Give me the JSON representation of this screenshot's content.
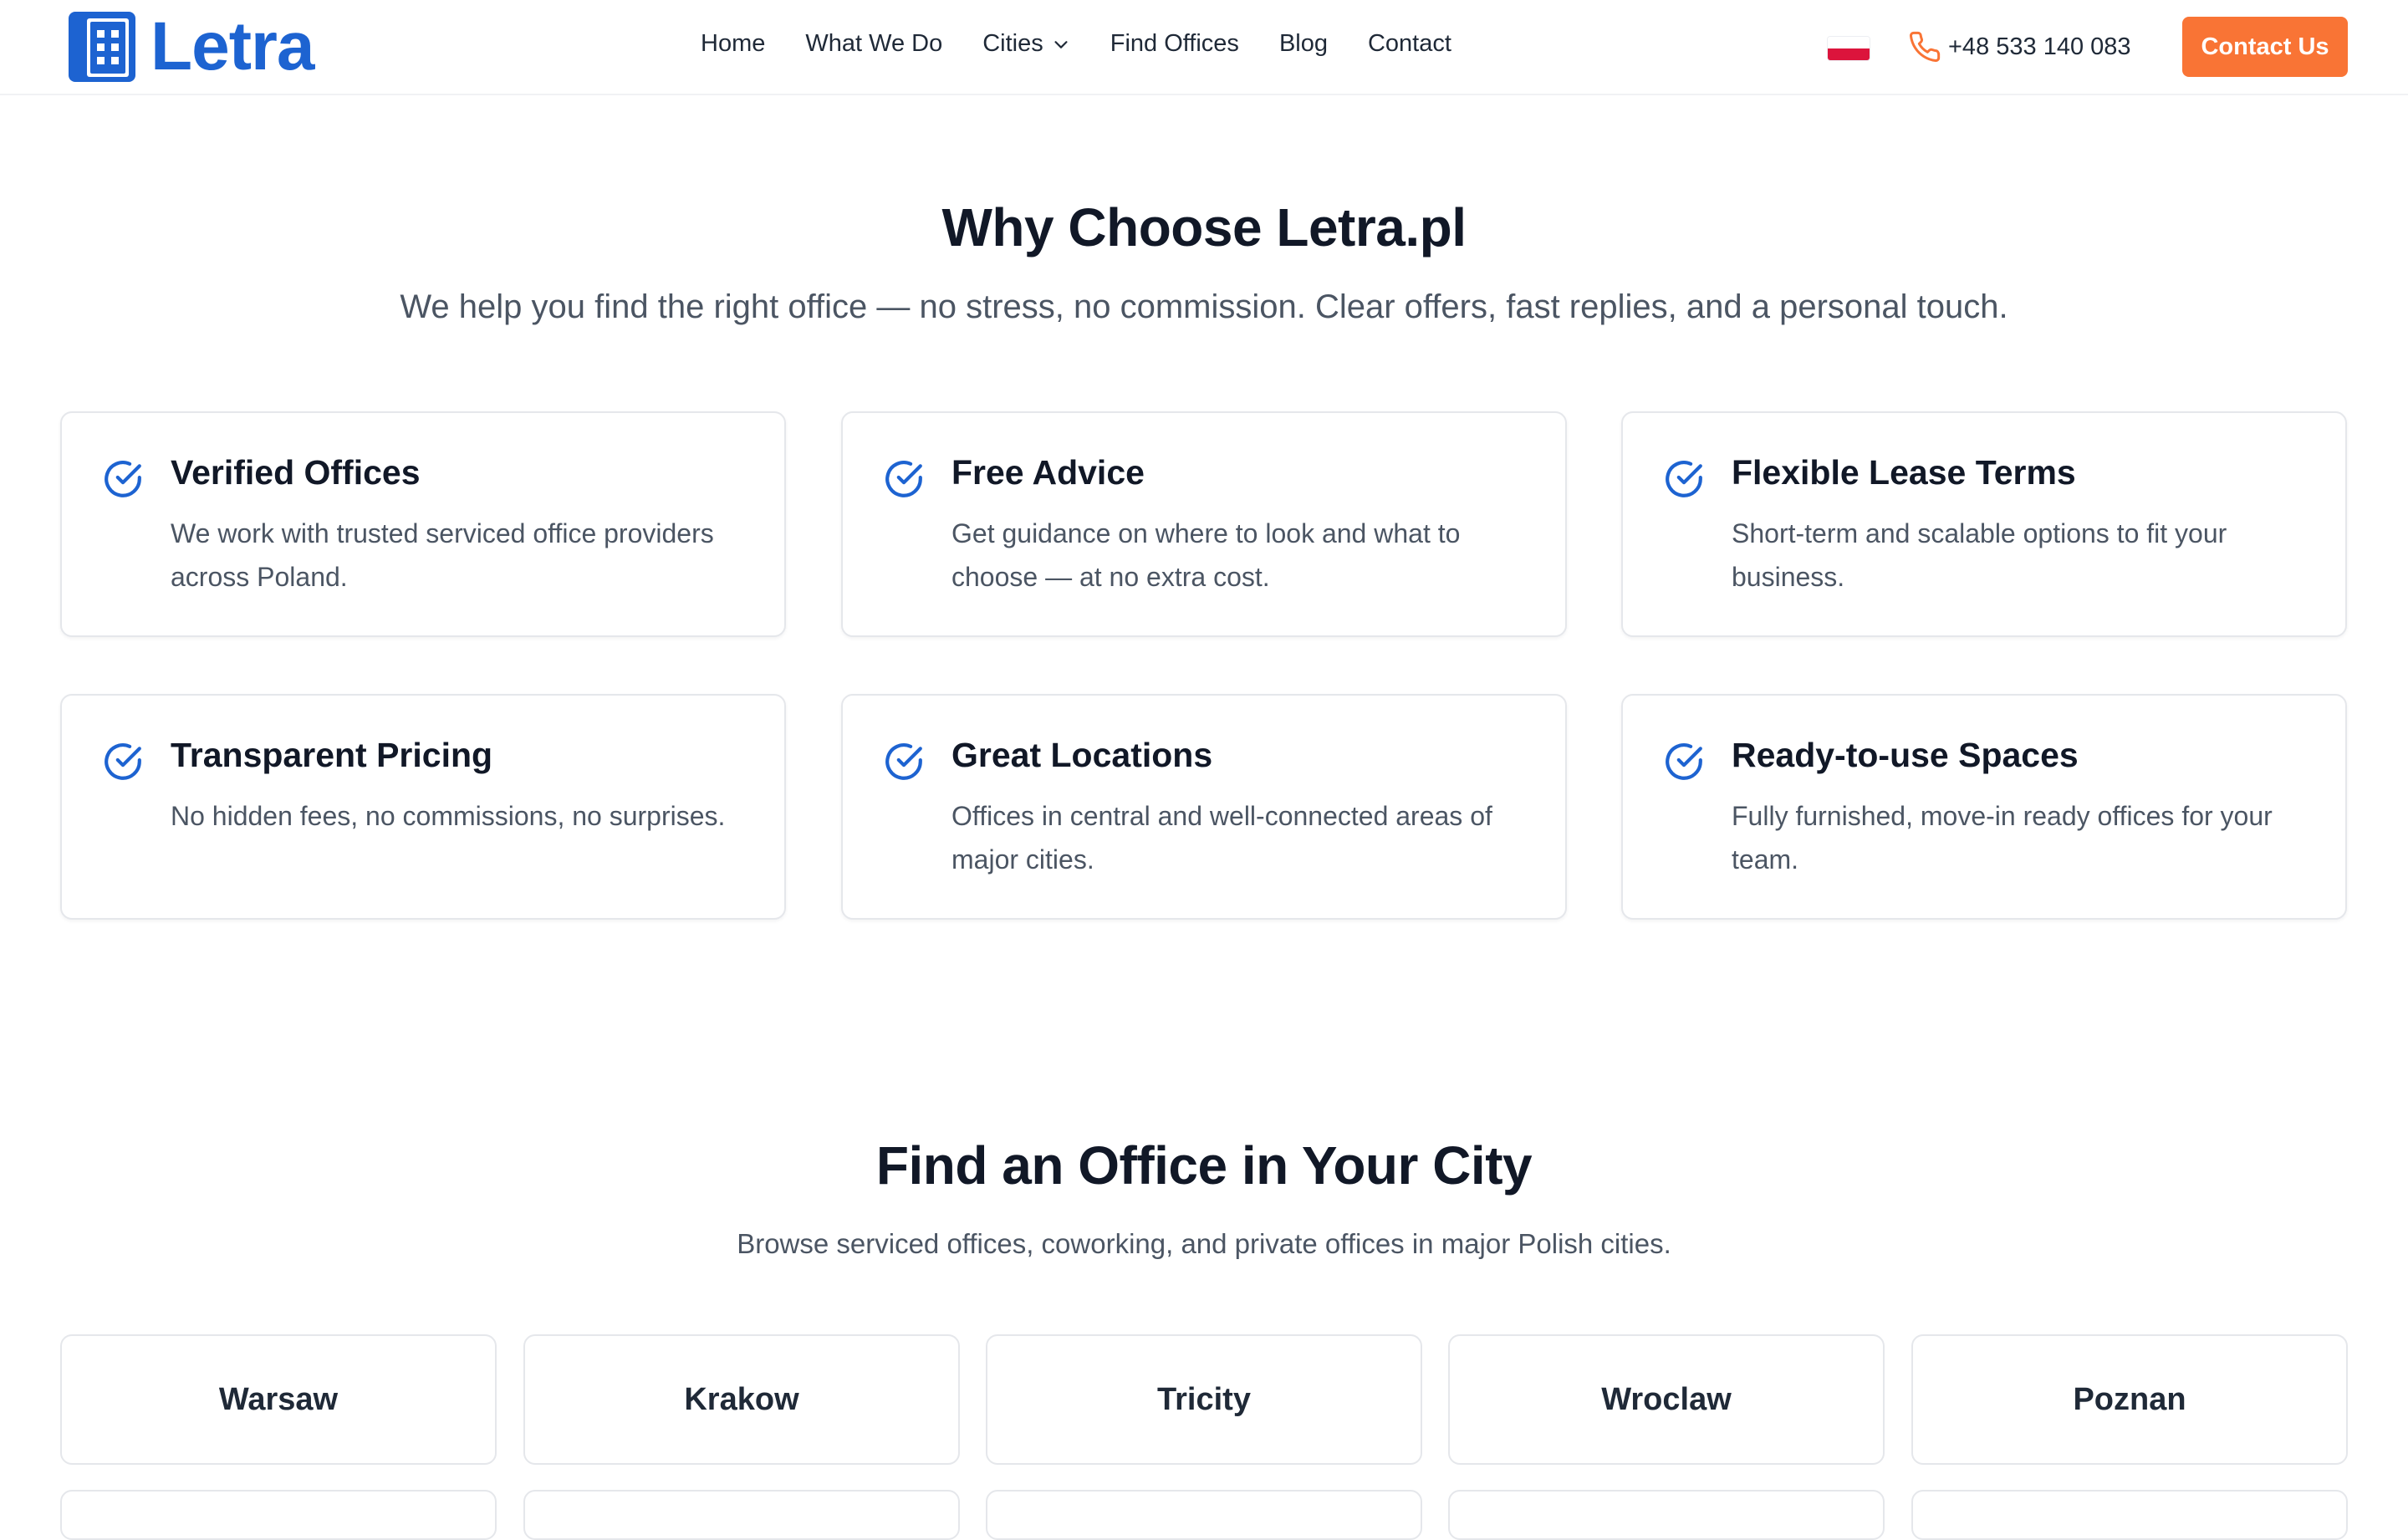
{
  "brand": {
    "name": "Letra",
    "color": "#1d63d1",
    "icon": "office-building-icon"
  },
  "nav": {
    "items": [
      {
        "label": "Home"
      },
      {
        "label": "What We Do"
      },
      {
        "label": "Cities",
        "has_dropdown": true
      },
      {
        "label": "Find Offices"
      },
      {
        "label": "Blog"
      },
      {
        "label": "Contact"
      }
    ]
  },
  "language": {
    "icon": "poland-flag-icon"
  },
  "phone": {
    "number": "+48 533 140 083",
    "icon": "phone-icon"
  },
  "cta": {
    "label": "Contact Us",
    "color": "#f97435"
  },
  "why": {
    "title": "Why Choose Letra.pl",
    "subtitle": "We help you find the right office — no stress, no commission. Clear offers, fast replies, and a personal touch.",
    "features": [
      {
        "title": "Verified Offices",
        "description": "We work with trusted serviced office providers across Poland."
      },
      {
        "title": "Free Advice",
        "description": "Get guidance on where to look and what to choose — at no extra cost."
      },
      {
        "title": "Flexible Lease Terms",
        "description": "Short-term and scalable options to fit your business."
      },
      {
        "title": "Transparent Pricing",
        "description": "No hidden fees, no commissions, no surprises."
      },
      {
        "title": "Great Locations",
        "description": "Offices in central and well-connected areas of major cities."
      },
      {
        "title": "Ready-to-use Spaces",
        "description": "Fully furnished, move-in ready offices for your team."
      }
    ]
  },
  "cities": {
    "title": "Find an Office in Your City",
    "subtitle": "Browse serviced offices, coworking, and private offices in major Polish cities.",
    "items": [
      {
        "name": "Warsaw"
      },
      {
        "name": "Krakow"
      },
      {
        "name": "Tricity"
      },
      {
        "name": "Wroclaw"
      },
      {
        "name": "Poznan"
      }
    ]
  }
}
